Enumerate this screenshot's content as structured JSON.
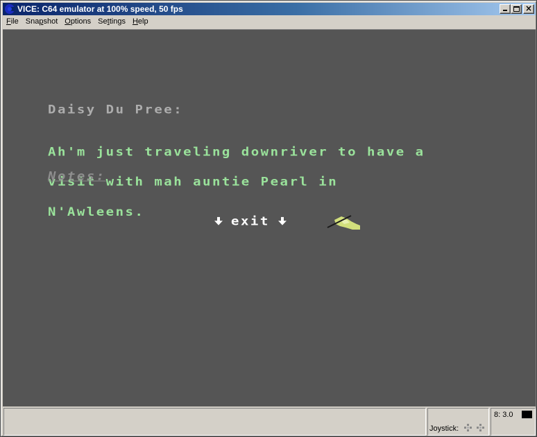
{
  "window": {
    "title": "VICE: C64 emulator at 100% speed, 50 fps",
    "buttons": {
      "minimize": "minimize",
      "maximize": "maximize",
      "close": "×"
    }
  },
  "menu": [
    {
      "label": "File",
      "mnemonic": "F",
      "rest": "ile"
    },
    {
      "label": "Snapshot",
      "pre": "Sna",
      "mnemonic": "p",
      "rest": "shot"
    },
    {
      "label": "Options",
      "mnemonic": "O",
      "rest": "ptions"
    },
    {
      "label": "Settings",
      "pre": "Se",
      "mnemonic": "t",
      "rest": "tings"
    },
    {
      "label": "Help",
      "mnemonic": "H",
      "rest": "elp"
    }
  ],
  "game": {
    "speaker": "Daisy Du Pree:",
    "speech_lines": [
      "Ah'm just traveling downriver to have a",
      "visit with mah auntie Pearl in",
      "N'Awleens."
    ],
    "notes_label": "Notes:",
    "exit_label": "exit",
    "colors": {
      "background": "#555555",
      "speaker": "#adadad",
      "speech": "#9ae29b",
      "notes": "#8e8e8e",
      "exit": "#ffffff"
    }
  },
  "statusbar": {
    "message": "",
    "joystick_label": "Joystick:",
    "drive_label": "8: 3.0"
  }
}
